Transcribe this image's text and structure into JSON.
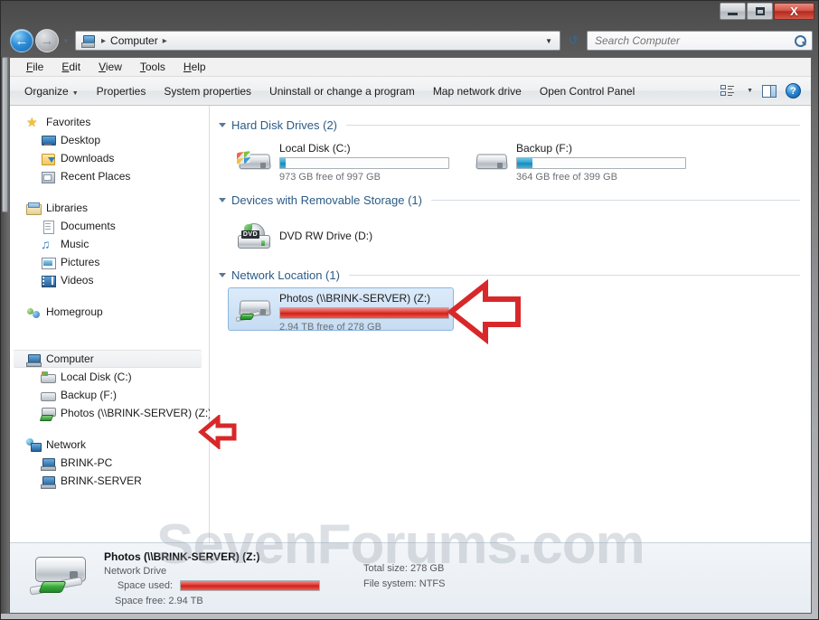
{
  "window": {
    "title": "Computer",
    "minimize_label": "Minimize",
    "maximize_label": "Maximize",
    "close_label": "X"
  },
  "address": {
    "crumb_root": "Computer",
    "separator": "▸"
  },
  "search": {
    "placeholder": "Search Computer",
    "value": ""
  },
  "menu": {
    "items": [
      {
        "label": "File",
        "accesskey": "F"
      },
      {
        "label": "Edit",
        "accesskey": "E"
      },
      {
        "label": "View",
        "accesskey": "V"
      },
      {
        "label": "Tools",
        "accesskey": "T"
      },
      {
        "label": "Help",
        "accesskey": "H"
      }
    ]
  },
  "toolbar": {
    "organize": "Organize",
    "properties": "Properties",
    "system_properties": "System properties",
    "uninstall": "Uninstall or change a program",
    "map_network_drive": "Map network drive",
    "open_control_panel": "Open Control Panel",
    "help_glyph": "?"
  },
  "sidebar": {
    "groups": [
      {
        "header": {
          "label": "Favorites",
          "icon": "star-icon"
        },
        "items": [
          {
            "label": "Desktop",
            "icon": "desktop-icon"
          },
          {
            "label": "Downloads",
            "icon": "downloads-icon"
          },
          {
            "label": "Recent Places",
            "icon": "recent-places-icon"
          }
        ]
      },
      {
        "header": {
          "label": "Libraries",
          "icon": "libraries-icon"
        },
        "items": [
          {
            "label": "Documents",
            "icon": "documents-icon"
          },
          {
            "label": "Music",
            "icon": "music-icon"
          },
          {
            "label": "Pictures",
            "icon": "pictures-icon"
          },
          {
            "label": "Videos",
            "icon": "videos-icon"
          }
        ]
      },
      {
        "header": {
          "label": "Homegroup",
          "icon": "homegroup-icon"
        },
        "items": []
      },
      {
        "header": {
          "label": "Computer",
          "icon": "computer-icon",
          "selected": true
        },
        "items": [
          {
            "label": "Local Disk (C:)",
            "icon": "harddisk-icon"
          },
          {
            "label": "Backup (F:)",
            "icon": "harddisk-plain-icon"
          },
          {
            "label": "Photos (\\\\BRINK-SERVER) (Z:)",
            "icon": "network-drive-icon"
          }
        ]
      },
      {
        "header": {
          "label": "Network",
          "icon": "network-icon"
        },
        "items": [
          {
            "label": "BRINK-PC",
            "icon": "computer-node-icon"
          },
          {
            "label": "BRINK-SERVER",
            "icon": "computer-node-icon"
          }
        ]
      }
    ]
  },
  "content": {
    "groups": [
      {
        "title": "Hard Disk Drives (2)",
        "drives": [
          {
            "name": "Local Disk (C:)",
            "free_text": "973 GB free of 997 GB",
            "bar": {
              "percent": 3,
              "color": "blue"
            },
            "icon": "system-harddisk-icon",
            "selected": false
          },
          {
            "name": "Backup (F:)",
            "free_text": "364 GB free of 399 GB",
            "bar": {
              "percent": 9,
              "color": "blue"
            },
            "icon": "harddisk-icon",
            "selected": false
          }
        ]
      },
      {
        "title": "Devices with Removable Storage (1)",
        "drives": [
          {
            "name": "DVD RW Drive (D:)",
            "free_text": "",
            "bar": null,
            "icon": "dvd-drive-icon",
            "selected": false,
            "badge": "DVD"
          }
        ]
      },
      {
        "title": "Network Location (1)",
        "drives": [
          {
            "name": "Photos (\\\\BRINK-SERVER) (Z:)",
            "free_text": "2.94 TB free of 278 GB",
            "bar": {
              "percent": 100,
              "color": "red"
            },
            "icon": "network-drive-icon",
            "selected": true
          }
        ]
      }
    ]
  },
  "details": {
    "title": "Photos (\\\\BRINK-SERVER) (Z:)",
    "type": "Network Drive",
    "space_used_label": "Space used:",
    "space_used_bar": {
      "percent": 100,
      "color": "red"
    },
    "space_free_label": "Space free:",
    "space_free_value": "2.94 TB",
    "total_size_label": "Total size:",
    "total_size_value": "278 GB",
    "file_system_label": "File system:",
    "file_system_value": "NTFS"
  },
  "watermark": {
    "text": "SevenForums.com"
  },
  "annotations": [
    {
      "name": "arrow-pointing-to-network-location-tile",
      "direction": "left"
    },
    {
      "name": "arrow-pointing-to-sidebar-network-drive",
      "direction": "left"
    }
  ],
  "colors": {
    "accent_blue": "#2b5b86",
    "selection_blue": "#c6dcf3",
    "bar_blue": "#2da2cf",
    "bar_red": "#cc1f19",
    "annotation_red": "#d8282a",
    "title_close_red": "#b32a1d"
  }
}
